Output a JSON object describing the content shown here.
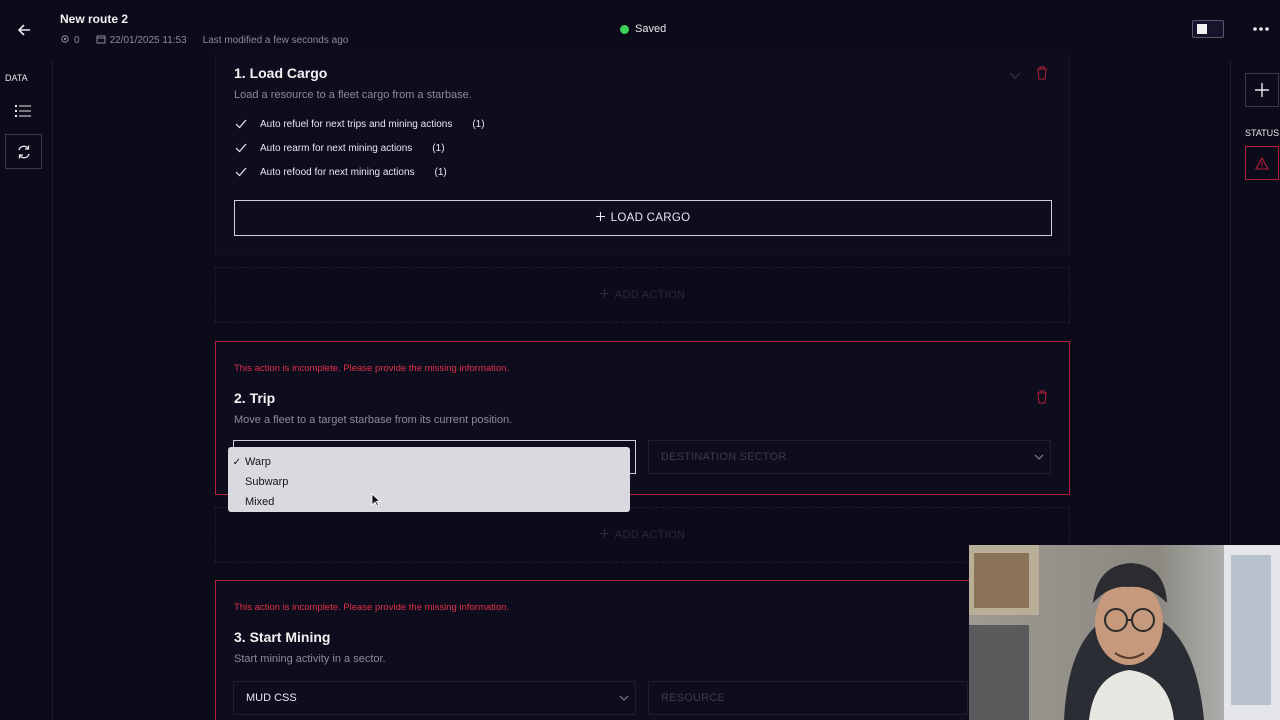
{
  "header": {
    "title": "New route 2",
    "count": "0",
    "date": "22/01/2025 11:53",
    "last_modified": "Last modified a few seconds ago",
    "status": "Saved"
  },
  "left_sidebar": {
    "label": "DATA"
  },
  "right_sidebar": {
    "label": "STATUS"
  },
  "actions": [
    {
      "title": "1. Load Cargo",
      "description": "Load a resource to a fleet cargo from a starbase.",
      "checks": [
        {
          "label": "Auto refuel for next trips and mining actions",
          "count": "(1)"
        },
        {
          "label": "Auto rearm for next mining actions",
          "count": "(1)"
        },
        {
          "label": "Auto refood for next mining actions",
          "count": "(1)"
        }
      ],
      "button": "LOAD CARGO"
    },
    {
      "error": "This action is incomplete. Please provide the missing information.",
      "title": "2. Trip",
      "description": "Move a fleet to a target starbase from its current position.",
      "destination_placeholder": "DESTINATION SECTOR"
    },
    {
      "error": "This action is incomplete. Please provide the missing information.",
      "title": "3. Start Mining",
      "description": "Start mining activity in a sector.",
      "select_value": "MUD CSS",
      "resource_placeholder": "RESOURCE"
    }
  ],
  "add_action_label": "ADD ACTION",
  "dropdown": {
    "options": [
      "Warp",
      "Subwarp",
      "Mixed"
    ],
    "selected": "Warp"
  },
  "colors": {
    "background": "#0c0b19",
    "error": "#e03048",
    "saved": "#3cd157"
  }
}
